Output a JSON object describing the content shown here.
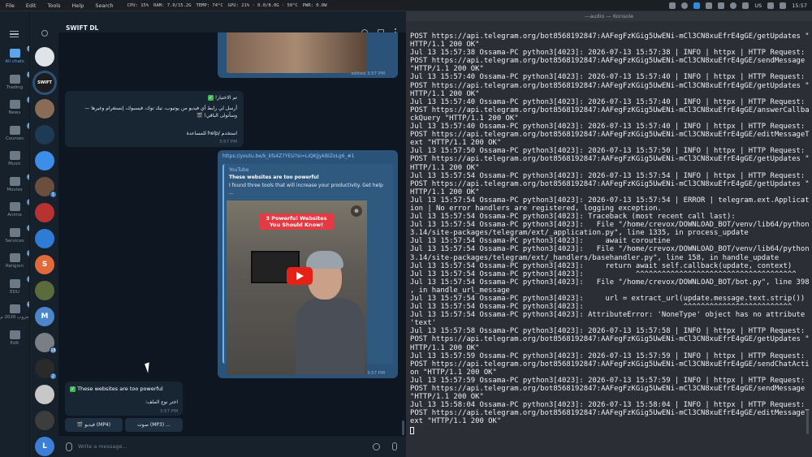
{
  "menubar": {
    "items": [
      "File",
      "Edit",
      "Tools",
      "Help",
      "Search"
    ],
    "stats": [
      "CPU: 15%",
      "RAM: 7.0/15.2G",
      "TEMP: 74°C",
      "GPU: 21% · 0.0/8.0G · 50°C",
      "PWR: 0.0W"
    ],
    "lang": "US",
    "clock": "15:57"
  },
  "terminal": {
    "title": "—audio — Konsole",
    "lines": [
      "POST https://api.telegram.org/bot8568192847:AAFegFzKGig5UwENi-mCl3CN8xuEfrE4gGE/getUpdates \"",
      "HTTP/1.1 200 OK\"",
      "Jul 13 15:57:38 Ossama-PC python3[4023]: 2026-07-13 15:57:38 | INFO | httpx | HTTP Request:",
      "POST https://api.telegram.org/bot8568192847:AAFegFzKGig5UwENi-mCl3CN8xuEfrE4gGE/sendMessage",
      "\"HTTP/1.1 200 OK\"",
      "Jul 13 15:57:40 Ossama-PC python3[4023]: 2026-07-13 15:57:40 | INFO | httpx | HTTP Request:",
      "POST https://api.telegram.org/bot8568192847:AAFegFzKGig5UwENi-mCl3CN8xuEfrE4gGE/getUpdates \"",
      "HTTP/1.1 200 OK\"",
      "Jul 13 15:57:40 Ossama-PC python3[4023]: 2026-07-13 15:57:40 | INFO | httpx | HTTP Request:",
      "POST https://api.telegram.org/bot8568192847:AAFegFzKGig5UwENi-mCl3CN8xuEfrE4gGE/answerCallba",
      "ckQuery \"HTTP/1.1 200 OK\"",
      "Jul 13 15:57:40 Ossama-PC python3[4023]: 2026-07-13 15:57:40 | INFO | httpx | HTTP Request:",
      "POST https://api.telegram.org/bot8568192847:AAFegFzKGig5UwENi-mCl3CN8xuEfrE4gGE/editMessageT",
      "ext \"HTTP/1.1 200 OK\"",
      "Jul 13 15:57:50 Ossama-PC python3[4023]: 2026-07-13 15:57:50 | INFO | httpx | HTTP Request:",
      "POST https://api.telegram.org/bot8568192847:AAFegFzKGig5UwENi-mCl3CN8xuEfrE4gGE/getUpdates \"",
      "HTTP/1.1 200 OK\"",
      "Jul 13 15:57:54 Ossama-PC python3[4023]: 2026-07-13 15:57:54 | INFO | httpx | HTTP Request:",
      "POST https://api.telegram.org/bot8568192847:AAFegFzKGig5UwENi-mCl3CN8xuEfrE4gGE/getUpdates \"",
      "HTTP/1.1 200 OK\"",
      "Jul 13 15:57:54 Ossama-PC python3[4023]: 2026-07-13 15:57:54 | ERROR | telegram.ext.Applicat",
      "ion | No error handlers are registered, logging exception.",
      "Jul 13 15:57:54 Ossama-PC python3[4023]: Traceback (most recent call last):",
      "Jul 13 15:57:54 Ossama-PC python3[4023]:   File \"/home/crevox/DOWNLOAD_BOT/venv/lib64/python",
      "3.14/site-packages/telegram/ext/_application.py\", line 1335, in process_update",
      "Jul 13 15:57:54 Ossama-PC python3[4023]:     await coroutine",
      "Jul 13 15:57:54 Ossama-PC python3[4023]:   File \"/home/crevox/DOWNLOAD_BOT/venv/lib64/python",
      "3.14/site-packages/telegram/ext/_handlers/basehandler.py\", line 158, in handle_update",
      "Jul 13 15:57:54 Ossama-PC python3[4023]:     return await self.callback(update, context)",
      "Jul 13 15:57:54 Ossama-PC python3[4023]:            ^^^^^^^^^^^^^^^^^^^^^^^^^^^^^^^^^^^^^",
      "Jul 13 15:57:54 Ossama-PC python3[4023]:   File \"/home/crevox/DOWNLOAD_BOT/bot.py\", line 398",
      ", in handle_url_message",
      "Jul 13 15:57:54 Ossama-PC python3[4023]:     url = extract_url(update.message.text.strip())",
      "Jul 13 15:57:54 Ossama-PC python3[4023]:                       ^^^^^^^^^^^^^^^^^^^^^^^^^",
      "Jul 13 15:57:54 Ossama-PC python3[4023]: AttributeError: 'NoneType' object has no attribute",
      "'text'",
      "Jul 13 15:57:58 Ossama-PC python3[4023]: 2026-07-13 15:57:58 | INFO | httpx | HTTP Request:",
      "POST https://api.telegram.org/bot8568192847:AAFegFzKGig5UwENi-mCl3CN8xuEfrE4gGE/getUpdates \"",
      "HTTP/1.1 200 OK\"",
      "Jul 13 15:57:59 Ossama-PC python3[4023]: 2026-07-13 15:57:59 | INFO | httpx | HTTP Request:",
      "POST https://api.telegram.org/bot8568192847:AAFegFzKGig5UwENi-mCl3CN8xuEfrE4gGE/sendChatActi",
      "on \"HTTP/1.1 200 OK\"",
      "Jul 13 15:57:59 Ossama-PC python3[4023]: 2026-07-13 15:57:59 | INFO | httpx | HTTP Request:",
      "POST https://api.telegram.org/bot8568192847:AAFegFzKGig5UwENi-mCl3CN8xuEfrE4gGE/sendMessage",
      "\"HTTP/1.1 200 OK\"",
      "Jul 13 15:58:04 Ossama-PC python3[4023]: 2026-07-13 15:58:04 | INFO | httpx | HTTP Request:",
      "POST https://api.telegram.org/bot8568192847:AAFegFzKGig5UwENi-mCl3CN8xuEfrE4gGE/editMessageT",
      "ext \"HTTP/1.1 200 OK\""
    ]
  },
  "telegram": {
    "folders": [
      {
        "label": "All chats",
        "badge": "5",
        "active": true
      },
      {
        "label": "Trading",
        "badge": "23"
      },
      {
        "label": "News",
        "badge": "33"
      },
      {
        "label": "Courses",
        "badge": "10"
      },
      {
        "label": "Music",
        "badge": ""
      },
      {
        "label": "Movies",
        "badge": "4"
      },
      {
        "label": "Anime",
        "badge": "3"
      },
      {
        "label": "Services",
        "badge": "13"
      },
      {
        "label": "Religion",
        "badge": "2"
      },
      {
        "label": "EDU",
        "badge": "3"
      },
      {
        "label": "جروب 2026 م",
        "badge": "29"
      },
      {
        "label": "Edit",
        "badge": ""
      }
    ],
    "chat_avatars": [
      {
        "color": "#e0e4e8",
        "letter": "",
        "badge": ""
      },
      {
        "color": "#1c1c1c",
        "letter": "SWIFT",
        "badge": ""
      },
      {
        "color": "#8a6b55",
        "letter": "",
        "badge": ""
      },
      {
        "color": "#1f3a55",
        "letter": "",
        "badge": ""
      },
      {
        "color": "#3c8ee8",
        "letter": "",
        "badge": ""
      },
      {
        "color": "#6b4e3d",
        "letter": "",
        "badge": "1"
      },
      {
        "color": "#b83232",
        "letter": "",
        "badge": ""
      },
      {
        "color": "#2f7bd6",
        "letter": "",
        "badge": ""
      },
      {
        "color": "#e06a3a",
        "letter": "S",
        "badge": ""
      },
      {
        "color": "#5c6b3c",
        "letter": "",
        "badge": ""
      },
      {
        "color": "#4a86c9",
        "letter": "M",
        "badge": ""
      },
      {
        "color": "#7a7f86",
        "letter": "",
        "badge": "18"
      },
      {
        "color": "#2a2a2a",
        "letter": "",
        "badge": "2"
      },
      {
        "color": "#c7c7c7",
        "letter": "",
        "badge": ""
      },
      {
        "color": "#3d3d3d",
        "letter": "",
        "badge": ""
      },
      {
        "color": "#3d7fd6",
        "letter": "L",
        "badge": ""
      }
    ],
    "chat": {
      "name": "SWIFT DL",
      "status": "bot",
      "msg1_time": "edited 3:57 PM",
      "msg2": {
        "title": "تم الاختيار!",
        "body": "أرسل لي رابط أي فيديو من يوتيوب، تيك توك، فيسبوك، إنستغرام وغيرها — وسأتولى الباقي! 🎬",
        "help": "استخدم /help للمساعدة",
        "time": "3:57 PM"
      },
      "msg3": {
        "link": "https://youtu.be/k_kfs4Z7YEU?si=LiQKJjykBlZoLg6_#1",
        "site": "YouTube",
        "title": "These websites are too powerful",
        "desc": "I found three tools that will increase your productivity. Get help ...",
        "video_title": "3 Powerful Websites You Should Know!",
        "time": "3:57 PM"
      },
      "msg4": {
        "title": "These websites are too powerful",
        "prompt": "اختر نوع الملف:",
        "time": "3:57 PM",
        "btn_video": "🎬 فيديو (MP4)",
        "btn_audio": "صوت (MP3) ..."
      },
      "composer_placeholder": "Write a message..."
    }
  }
}
